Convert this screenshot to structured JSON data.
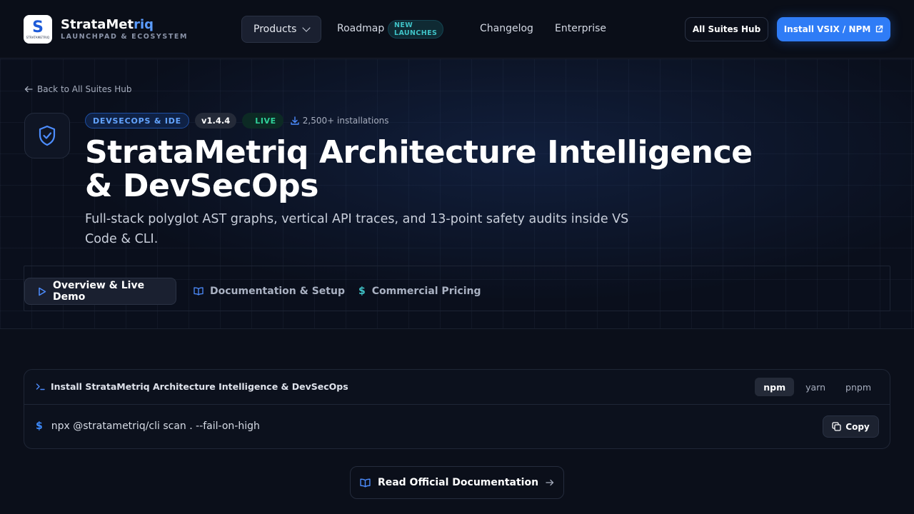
{
  "brand": {
    "name_main": "StrataMet",
    "name_highlight": "riq",
    "tagline": "LAUNCHPAD & ECOSYSTEM",
    "logo_letter": "S",
    "logo_text": "STRATAMETRIQ"
  },
  "nav": {
    "products": "Products",
    "roadmap": "Roadmap",
    "roadmap_badge": "NEW LAUNCHES",
    "changelog": "Changelog",
    "enterprise": "Enterprise"
  },
  "header_actions": {
    "hub": "All Suites Hub",
    "install": "Install VSIX / NPM"
  },
  "hero": {
    "back": "Back to All Suites Hub",
    "category": "DEVSECOPS & IDE",
    "version": "v1.4.4",
    "status": "LIVE",
    "installs": "2,500+ installations",
    "title": "StrataMetriq Architecture Intelligence & DevSecOps",
    "subtitle": "Full-stack polyglot AST graphs, vertical API traces, and 13-point safety audits inside VS Code & CLI."
  },
  "tabs": [
    {
      "label": "Overview & Live Demo"
    },
    {
      "label": "Documentation & Setup"
    },
    {
      "label": "Commercial Pricing"
    }
  ],
  "install_card": {
    "title": "Install StrataMetriq Architecture Intelligence & DevSecOps",
    "managers": [
      "npm",
      "yarn",
      "pnpm"
    ],
    "selected_manager": "npm",
    "prompt": "$",
    "command": "npx @stratametriq/cli scan . --fail-on-high",
    "copy": "Copy"
  },
  "docs_button": "Read Official Documentation",
  "colors": {
    "accent": "#2f7cf6",
    "live": "#2fd19a",
    "teal": "#3fc2c7",
    "background": "#0b0f1a"
  }
}
